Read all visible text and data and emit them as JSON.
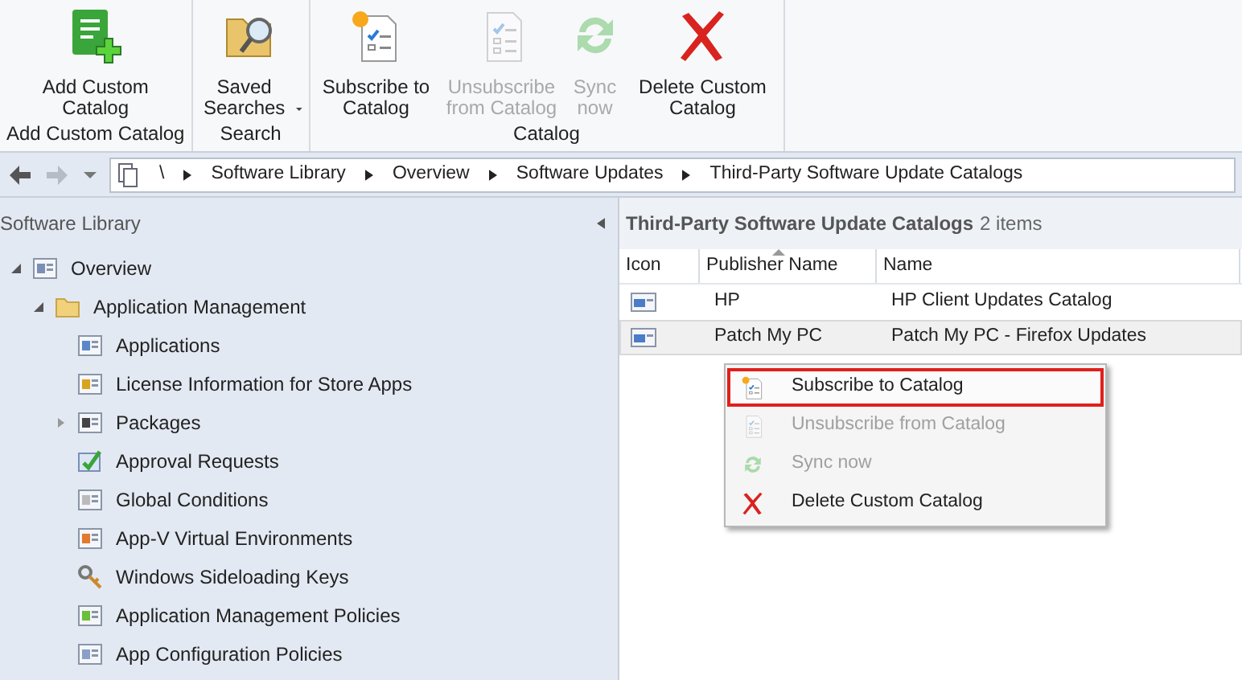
{
  "ribbon": {
    "groups": [
      {
        "label": "Add Custom Catalog",
        "buttons": [
          {
            "kind": "add",
            "label": "Add Custom Catalog",
            "disabled": false,
            "dropdown": false
          }
        ]
      },
      {
        "label": "Search",
        "buttons": [
          {
            "kind": "search",
            "label": "Saved Searches",
            "disabled": false,
            "dropdown": true
          }
        ]
      },
      {
        "label": "Catalog",
        "buttons": [
          {
            "kind": "subscribe",
            "label": "Subscribe to Catalog",
            "disabled": false,
            "dropdown": false
          },
          {
            "kind": "unsubscribe",
            "label": "Unsubscribe from Catalog",
            "disabled": true,
            "dropdown": false
          },
          {
            "kind": "sync",
            "label": "Sync now",
            "disabled": true,
            "dropdown": false
          },
          {
            "kind": "delete",
            "label": "Delete Custom Catalog",
            "disabled": false,
            "dropdown": false
          }
        ]
      }
    ]
  },
  "breadcrumb": [
    "\\",
    "Software Library",
    "Overview",
    "Software Updates",
    "Third-Party Software Update Catalogs"
  ],
  "sidebar": {
    "title": "Software Library",
    "tree": [
      {
        "label": "Overview",
        "kind": "overview",
        "expanded": true,
        "children": [
          {
            "label": "Application Management",
            "kind": "folder",
            "expanded": true,
            "children": [
              {
                "label": "Applications",
                "kind": "app"
              },
              {
                "label": "License Information for Store Apps",
                "kind": "license"
              },
              {
                "label": "Packages",
                "kind": "package",
                "expanded": false
              },
              {
                "label": "Approval Requests",
                "kind": "approval"
              },
              {
                "label": "Global Conditions",
                "kind": "conditions"
              },
              {
                "label": "App-V Virtual Environments",
                "kind": "appv"
              },
              {
                "label": "Windows Sideloading Keys",
                "kind": "key"
              },
              {
                "label": "Application Management Policies",
                "kind": "policy"
              },
              {
                "label": "App Configuration Policies",
                "kind": "config"
              }
            ]
          }
        ]
      }
    ]
  },
  "list": {
    "title": "Third-Party Software Update Catalogs",
    "count": "2 items",
    "columns": [
      {
        "label": "Icon",
        "sorted": false
      },
      {
        "label": "Publisher Name",
        "sorted": true
      },
      {
        "label": "Name",
        "sorted": false
      }
    ],
    "rows": [
      {
        "publisher": "HP",
        "name": "HP Client Updates Catalog",
        "selected": false
      },
      {
        "publisher": "Patch My PC",
        "name": "Patch My PC - Firefox Updates",
        "selected": true
      }
    ]
  },
  "context_menu": [
    {
      "kind": "subscribe",
      "label": "Subscribe to Catalog",
      "disabled": false,
      "selected": true
    },
    {
      "kind": "unsubscribe",
      "label": "Unsubscribe from Catalog",
      "disabled": true,
      "selected": false
    },
    {
      "kind": "sync",
      "label": "Sync now",
      "disabled": true,
      "selected": false
    },
    {
      "kind": "delete",
      "label": "Delete Custom Catalog",
      "disabled": false,
      "selected": false
    }
  ]
}
